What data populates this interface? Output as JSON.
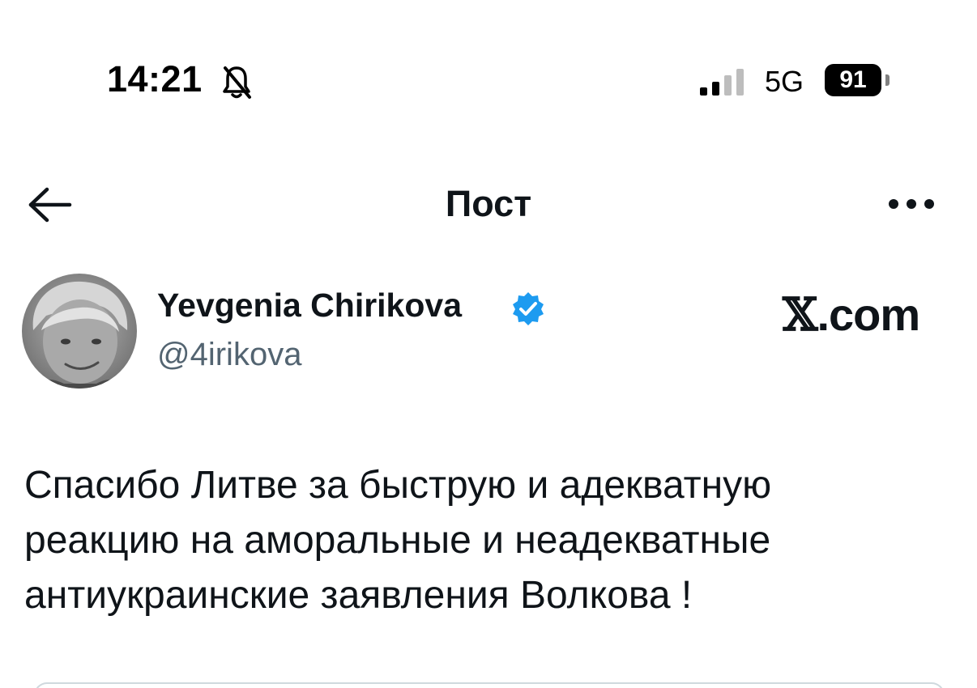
{
  "status_bar": {
    "time": "14:21",
    "network": "5G",
    "battery": "91"
  },
  "header": {
    "title": "Пост"
  },
  "author": {
    "name": "Yevgenia Chirikova",
    "handle": "@4irikova"
  },
  "watermark": {
    "x_letter": "𝕏",
    "domain": ".com"
  },
  "tweet": {
    "lines": [
      "Спасибо Литве за быструю и адекватную",
      "реакцию на аморальные и неадекватные",
      "антиукраинские заявления Волкова !"
    ]
  },
  "colors": {
    "text": "#0f1419",
    "secondary": "#536471",
    "verified": "#1d9bf0"
  },
  "icons": [
    "bell-off-icon",
    "signal-icon",
    "battery-icon",
    "back-arrow-icon",
    "more-icon",
    "verified-icon"
  ]
}
